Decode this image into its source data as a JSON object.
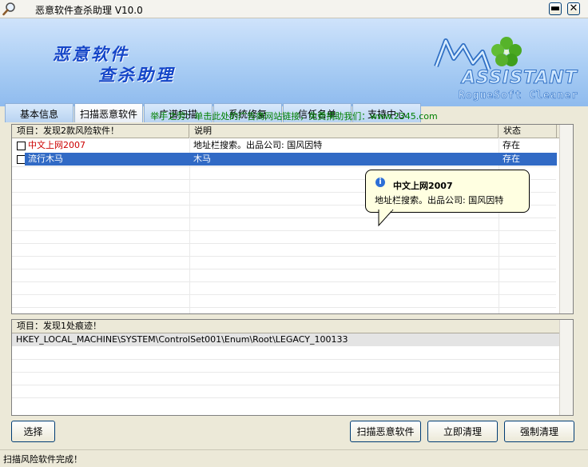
{
  "window": {
    "title": "恶意软件查杀助理 V10.0",
    "minimize": "▬",
    "close": "✕"
  },
  "banner": {
    "line1": "恶意软件",
    "line2": "查杀助理",
    "logo_text": "ASSISTANT",
    "logo_sub": "RogueSoft Cleaner"
  },
  "tabs": [
    {
      "label": "基本信息",
      "active": false
    },
    {
      "label": "扫描恶意软件",
      "active": true
    },
    {
      "label": "广谱扫描",
      "active": false
    },
    {
      "label": "系统修复",
      "active": false
    },
    {
      "label": "信任名单",
      "active": false
    },
    {
      "label": "支持中心",
      "active": false
    }
  ],
  "notice": "举手之劳：单击此处的广告商网站链接，免费捐助我们：www.2345.com",
  "list": {
    "headers": [
      "项目：发现2款风险软件！",
      "说明",
      "状态"
    ],
    "rows": [
      {
        "name": "中文上网2007",
        "desc": "地址栏搜索。出品公司: 国风因特",
        "status": "存在",
        "checked": false,
        "selected": false
      },
      {
        "name": "流行木马",
        "desc": "木马",
        "status": "存在",
        "checked": false,
        "selected": true
      }
    ]
  },
  "tooltip": {
    "title": "中文上网2007",
    "body": "地址栏搜索。出品公司:  国风因特",
    "icon": "info-icon"
  },
  "traces": {
    "header": "项目：发现1处痕迹！",
    "rows": [
      "HKEY_LOCAL_MACHINE\\SYSTEM\\ControlSet001\\Enum\\Root\\LEGACY_100133"
    ]
  },
  "buttons": {
    "select": "选择",
    "scan": "扫描恶意软件",
    "clean": "立即清理",
    "force": "强制清理"
  },
  "status": "扫描风险软件完成！",
  "colors": {
    "danger_text": "#cc0000",
    "selection": "#316ac5",
    "notice": "#008000",
    "accent": "#1546c8"
  }
}
